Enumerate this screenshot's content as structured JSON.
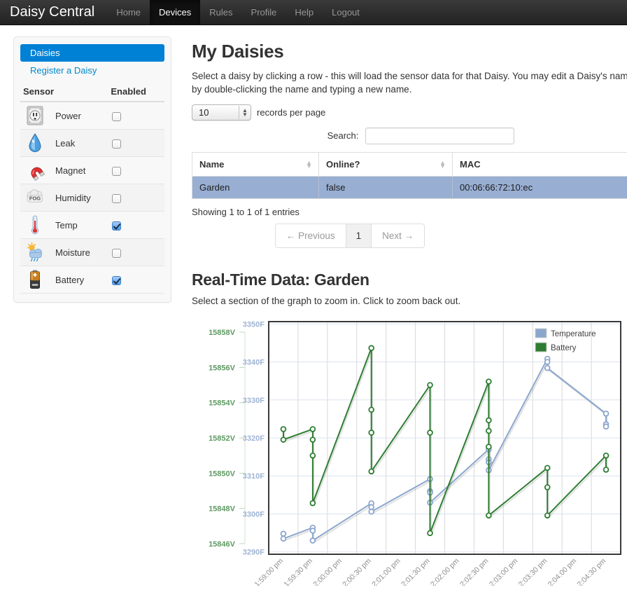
{
  "navbar": {
    "brand": "Daisy Central",
    "links": [
      {
        "label": "Home",
        "active": false
      },
      {
        "label": "Devices",
        "active": true
      },
      {
        "label": "Rules",
        "active": false
      },
      {
        "label": "Profile",
        "active": false
      },
      {
        "label": "Help",
        "active": false
      },
      {
        "label": "Logout",
        "active": false
      }
    ]
  },
  "sidebar": {
    "nav": [
      {
        "label": "Daisies",
        "active": true
      },
      {
        "label": "Register a Daisy",
        "active": false
      }
    ],
    "sensor_table": {
      "headers": {
        "sensor": "Sensor",
        "enabled": "Enabled"
      },
      "rows": [
        {
          "name": "Power",
          "icon": "power-outlet-icon",
          "enabled": false
        },
        {
          "name": "Leak",
          "icon": "water-drop-icon",
          "enabled": false
        },
        {
          "name": "Magnet",
          "icon": "magnet-icon",
          "enabled": false
        },
        {
          "name": "Humidity",
          "icon": "fog-cloud-icon",
          "enabled": false
        },
        {
          "name": "Temp",
          "icon": "thermometer-icon",
          "enabled": true
        },
        {
          "name": "Moisture",
          "icon": "sun-rain-cloud-icon",
          "enabled": false
        },
        {
          "name": "Battery",
          "icon": "battery-icon",
          "enabled": true
        }
      ]
    }
  },
  "main": {
    "title": "My Daisies",
    "lead_line1": "Select a daisy by clicking a row - this will load the sensor data for that Daisy. You may edit a Daisy's name",
    "lead_line2": "by double-clicking the name and typing a new name.",
    "page_length": {
      "value": "10",
      "suffix_label": "records per page"
    },
    "search": {
      "label": "Search:",
      "value": "",
      "placeholder": ""
    },
    "table": {
      "columns": [
        "Name",
        "Online?",
        "MAC"
      ],
      "rows": [
        {
          "name": "Garden",
          "online": "false",
          "mac": "00:06:66:72:10:ec",
          "selected": true
        }
      ]
    },
    "info": "Showing 1 to 1 of 1 entries",
    "pagination": {
      "previous": "← Previous",
      "page": "1",
      "next": "Next →"
    },
    "chart_title": "Real-Time Data: Garden",
    "chart_sub": "Select a section of the graph to zoom in. Click to zoom back out."
  },
  "footer": {
    "text": "",
    "truncated": true
  },
  "colors": {
    "navbar_bg": "#222222",
    "accent_link": "#0088cc",
    "sidebar_active": "#0081d6",
    "row_selected": "#98aed2",
    "temperature": "#8ba6cd",
    "battery": "#2e7d32"
  },
  "chart_data": {
    "type": "line",
    "title": "Real-Time Data: Garden",
    "xlabel": "",
    "ylabel": "",
    "grid": true,
    "legend_position": "top-right",
    "x": [
      "1:59:00 pm",
      "1:59:30 pm",
      "2:00:00 pm",
      "2:00:30 pm",
      "2:01:00 pm",
      "2:01:30 pm",
      "2:02:00 pm",
      "2:02:30 pm",
      "2:03:00 pm",
      "2:03:30 pm",
      "2:04:00 pm",
      "2:04:30 pm"
    ],
    "xtick_labels": [
      "1:59:00 pm",
      "1:59:30 pm",
      "2:00:00 pm",
      "2:00:30 pm",
      "2:01:00 pm",
      "2:01:30 pm",
      "2:02:00 pm",
      "2:02:30 pm",
      "2:03:00 pm",
      "2:03:30 pm",
      "2:04:00 pm",
      "2:04:30 pm"
    ],
    "axes": [
      {
        "name": "Battery",
        "unit": "V",
        "color": "#5f9a63",
        "side": "left-outer",
        "ylim": [
          15845.4,
          15858.6
        ],
        "ticks": [
          15846,
          15848,
          15850,
          15852,
          15854,
          15856,
          15858
        ],
        "tick_labels": [
          "15846V",
          "15848V",
          "15850V",
          "15852V",
          "15854V",
          "15856V",
          "15858V"
        ]
      },
      {
        "name": "Temperature",
        "unit": "F",
        "color": "#9fb4d4",
        "side": "left-inner",
        "ylim": [
          3289.4,
          3350.6
        ],
        "ticks": [
          3290,
          3300,
          3310,
          3320,
          3330,
          3340,
          3350
        ],
        "tick_labels": [
          "3290F",
          "3300F",
          "3310F",
          "3320F",
          "3330F",
          "3340F",
          "3350F"
        ]
      }
    ],
    "series": [
      {
        "name": "Temperature",
        "color": "#8ba6cd",
        "axis": "Temperature",
        "unit": "F",
        "points": [
          {
            "x": "1:59:00 pm",
            "y": 3294.8
          },
          {
            "x": "1:59:00 pm",
            "y": 3293.5
          },
          {
            "x": "1:59:30 pm",
            "y": 3296.4
          },
          {
            "x": "1:59:30 pm",
            "y": 3295.6
          },
          {
            "x": "1:59:30 pm",
            "y": 3293.0
          },
          {
            "x": "2:00:30 pm",
            "y": 3302.8
          },
          {
            "x": "2:00:30 pm",
            "y": 3301.8
          },
          {
            "x": "2:00:30 pm",
            "y": 3300.6
          },
          {
            "x": "2:01:30 pm",
            "y": 3309.2
          },
          {
            "x": "2:01:30 pm",
            "y": 3306.0
          },
          {
            "x": "2:01:30 pm",
            "y": 3305.6
          },
          {
            "x": "2:01:30 pm",
            "y": 3303.0
          },
          {
            "x": "2:02:30 pm",
            "y": 3317.0
          },
          {
            "x": "2:02:30 pm",
            "y": 3314.4
          },
          {
            "x": "2:02:30 pm",
            "y": 3313.6
          },
          {
            "x": "2:02:30 pm",
            "y": 3311.5
          },
          {
            "x": "2:03:30 pm",
            "y": 3340.8
          },
          {
            "x": "2:03:30 pm",
            "y": 3340.0
          },
          {
            "x": "2:03:30 pm",
            "y": 3338.4
          },
          {
            "x": "2:04:30 pm",
            "y": 3326.4
          },
          {
            "x": "2:04:30 pm",
            "y": 3323.6
          },
          {
            "x": "2:04:30 pm",
            "y": 3323.0
          }
        ]
      },
      {
        "name": "Battery",
        "color": "#2e7d32",
        "axis": "Battery",
        "unit": "V",
        "points": [
          {
            "x": "1:59:00 pm",
            "y": 15852.5
          },
          {
            "x": "1:59:00 pm",
            "y": 15851.9
          },
          {
            "x": "1:59:30 pm",
            "y": 15852.5
          },
          {
            "x": "1:59:30 pm",
            "y": 15851.9
          },
          {
            "x": "1:59:30 pm",
            "y": 15851.0
          },
          {
            "x": "1:59:30 pm",
            "y": 15848.3
          },
          {
            "x": "2:00:30 pm",
            "y": 15857.1
          },
          {
            "x": "2:00:30 pm",
            "y": 15853.6
          },
          {
            "x": "2:00:30 pm",
            "y": 15852.3
          },
          {
            "x": "2:00:30 pm",
            "y": 15850.1
          },
          {
            "x": "2:01:30 pm",
            "y": 15855.0
          },
          {
            "x": "2:01:30 pm",
            "y": 15852.3
          },
          {
            "x": "2:01:30 pm",
            "y": 15846.6
          },
          {
            "x": "2:02:30 pm",
            "y": 15855.2
          },
          {
            "x": "2:02:30 pm",
            "y": 15853.0
          },
          {
            "x": "2:02:30 pm",
            "y": 15852.4
          },
          {
            "x": "2:02:30 pm",
            "y": 15851.5
          },
          {
            "x": "2:02:30 pm",
            "y": 15847.6
          },
          {
            "x": "2:03:30 pm",
            "y": 15850.3
          },
          {
            "x": "2:03:30 pm",
            "y": 15849.2
          },
          {
            "x": "2:03:30 pm",
            "y": 15847.6
          },
          {
            "x": "2:04:30 pm",
            "y": 15851.0
          },
          {
            "x": "2:04:30 pm",
            "y": 15850.2
          }
        ]
      }
    ]
  }
}
